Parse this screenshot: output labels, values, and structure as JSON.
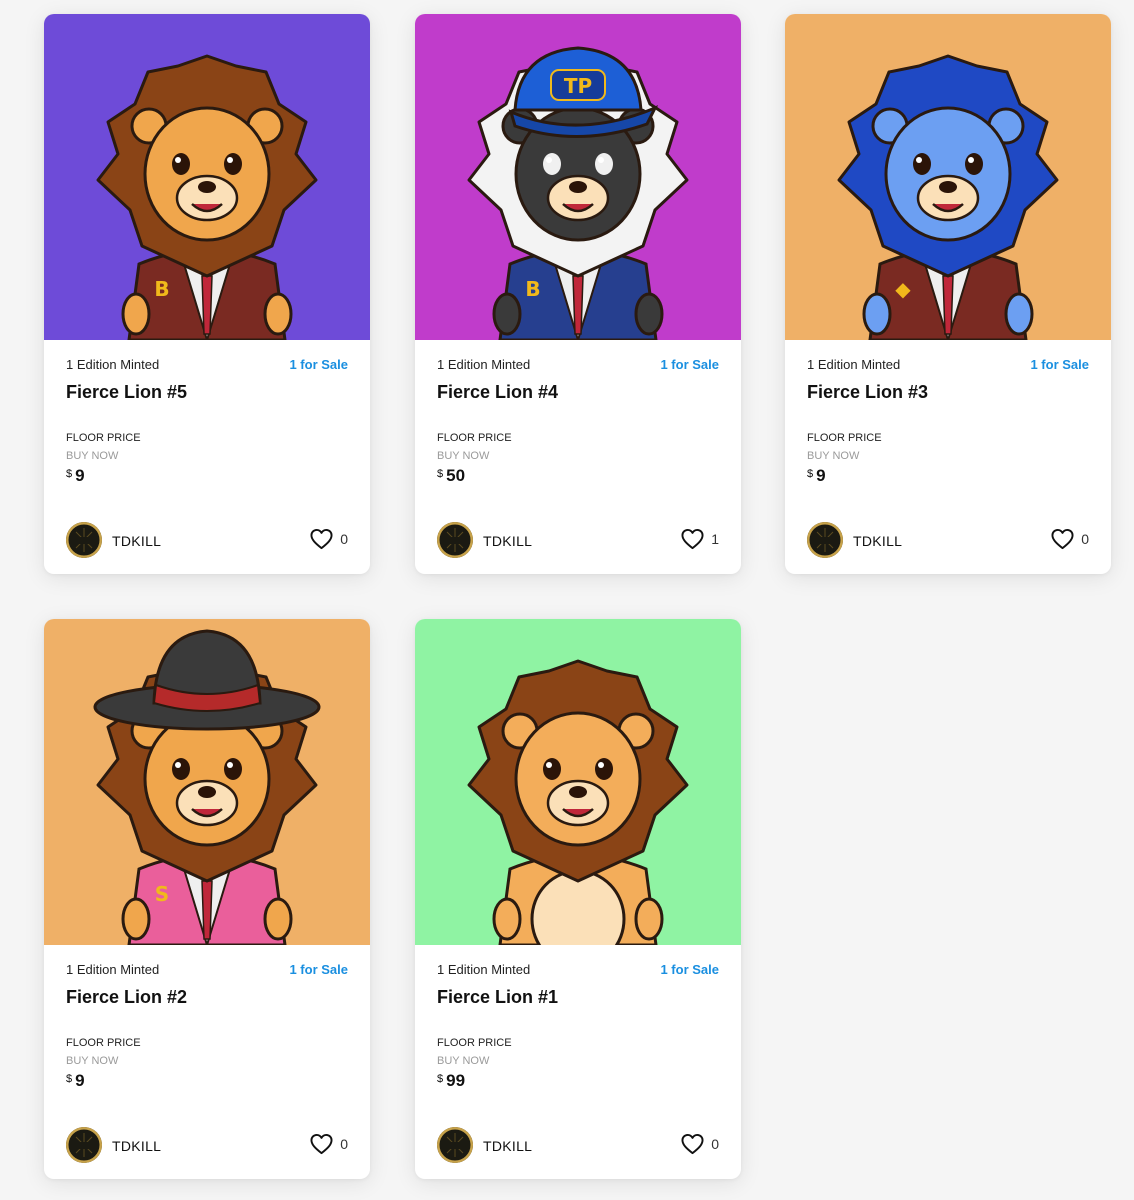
{
  "colors": {
    "accent": "#1a8fe0"
  },
  "icons": {
    "like": "heart-icon"
  },
  "cards": [
    {
      "edition": "1 Edition Minted",
      "sale": "1 for Sale",
      "title": "Fierce Lion #5",
      "floor_label": "FLOOR PRICE",
      "buy_label": "BUY NOW",
      "currency": "$",
      "price": "9",
      "creator": "TDKILL",
      "avatar_text": "TDKILL",
      "likes": "0",
      "bg": "#6e4bd8",
      "mane": "#8a4416",
      "face": "#f0a64c",
      "suit": "#7a2a22",
      "badge": "B"
    },
    {
      "edition": "1 Edition Minted",
      "sale": "1 for Sale",
      "title": "Fierce Lion #4",
      "floor_label": "FLOOR PRICE",
      "buy_label": "BUY NOW",
      "currency": "$",
      "price": "50",
      "creator": "TDKILL",
      "avatar_text": "TDKILL",
      "likes": "1",
      "bg": "#c03ccb",
      "mane": "#f3f3f3",
      "face": "#3a3a3a",
      "suit": "#263f8f",
      "badge": "B",
      "cap_text": "TP"
    },
    {
      "edition": "1 Edition Minted",
      "sale": "1 for Sale",
      "title": "Fierce Lion #3",
      "floor_label": "FLOOR PRICE",
      "buy_label": "BUY NOW",
      "currency": "$",
      "price": "9",
      "creator": "TDKILL",
      "avatar_text": "TDKILL",
      "likes": "0",
      "bg": "#efb067",
      "mane": "#1f49c4",
      "face": "#6c9ff2",
      "suit": "#7a2a22",
      "badge": "◆"
    },
    {
      "edition": "1 Edition Minted",
      "sale": "1 for Sale",
      "title": "Fierce Lion #2",
      "floor_label": "FLOOR PRICE",
      "buy_label": "BUY NOW",
      "currency": "$",
      "price": "9",
      "creator": "TDKILL",
      "avatar_text": "TDKILL",
      "likes": "0",
      "bg": "#efb067",
      "mane": "#8a4416",
      "face": "#f0a64c",
      "suit": "#ea5f9b",
      "badge": "S",
      "hat": true
    },
    {
      "edition": "1 Edition Minted",
      "sale": "1 for Sale",
      "title": "Fierce Lion #1",
      "floor_label": "FLOOR PRICE",
      "buy_label": "BUY NOW",
      "currency": "$",
      "price": "99",
      "creator": "TDKILL",
      "avatar_text": "TDKILL",
      "likes": "0",
      "bg": "#8ff3a3",
      "mane": "#8a4416",
      "face": "#f3ad5a",
      "suit": "#f3ad5a",
      "badge": ""
    }
  ]
}
